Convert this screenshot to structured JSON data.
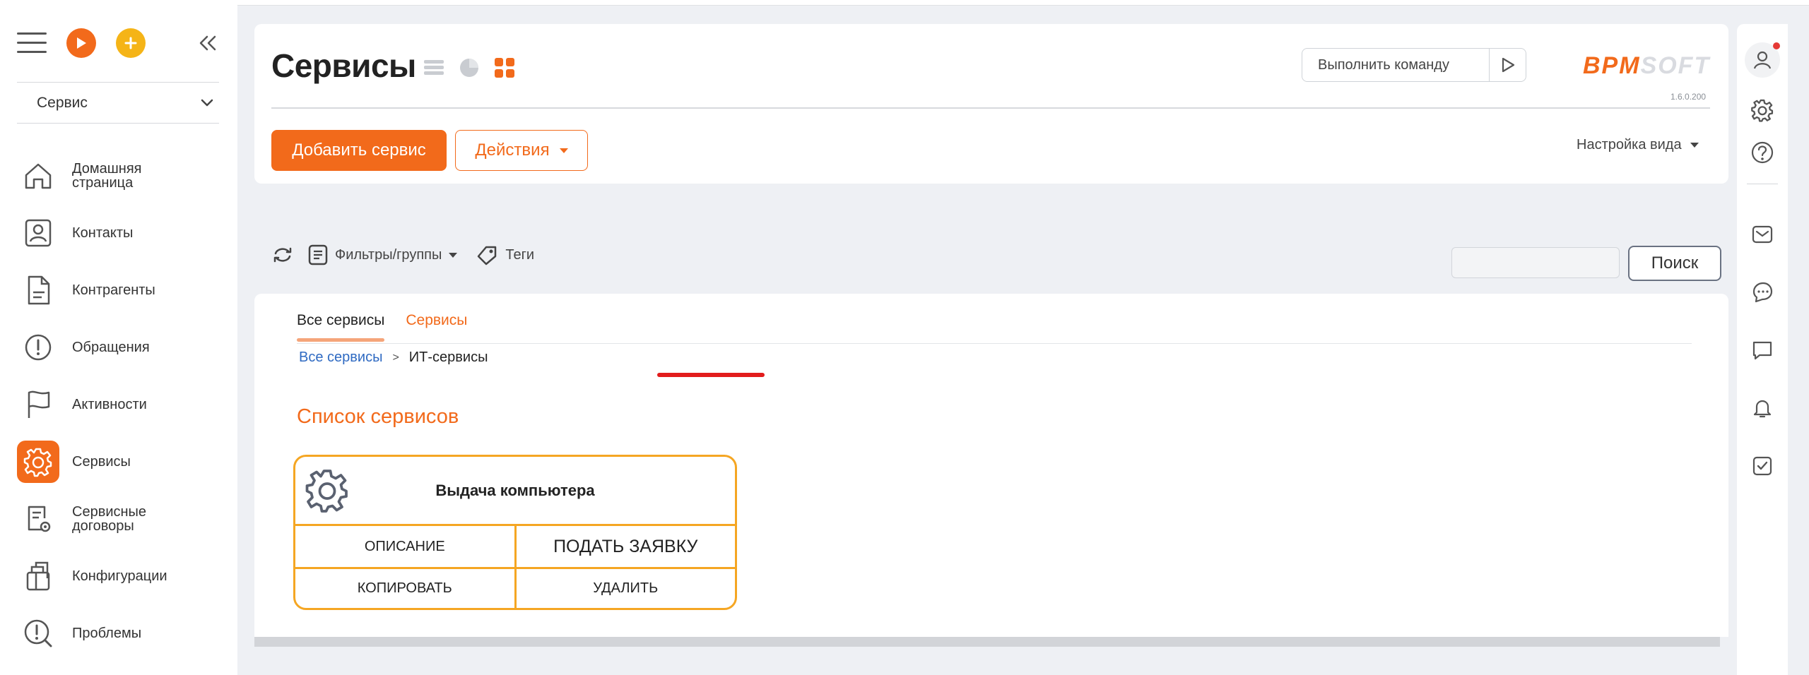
{
  "sidebar": {
    "workspace": "Сервис",
    "items": [
      {
        "label": "Домашняя страница",
        "icon": "home-icon",
        "active": false
      },
      {
        "label": "Контакты",
        "icon": "contact-icon",
        "active": false
      },
      {
        "label": "Контрагенты",
        "icon": "document-icon",
        "active": false
      },
      {
        "label": "Обращения",
        "icon": "alert-circle-icon",
        "active": false
      },
      {
        "label": "Активности",
        "icon": "flag-icon",
        "active": false
      },
      {
        "label": "Сервисы",
        "icon": "gear-icon",
        "active": true
      },
      {
        "label": "Сервисные договоры",
        "icon": "contract-icon",
        "active": false
      },
      {
        "label": "Конфигурации",
        "icon": "configuration-icon",
        "active": false
      },
      {
        "label": "Проблемы",
        "icon": "problem-icon",
        "active": false
      }
    ]
  },
  "header": {
    "title": "Сервисы",
    "command_placeholder": "Выполнить команду",
    "logo_left": "BPM",
    "logo_right": "SOFT",
    "version": "1.6.0.200",
    "add_button": "Добавить сервис",
    "actions_button": "Действия",
    "view_settings": "Настройка вида"
  },
  "filters": {
    "filters_label": "Фильтры/группы",
    "tags_label": "Теги",
    "search_button": "Поиск"
  },
  "content": {
    "tabs": [
      {
        "label": "Все сервисы",
        "active": true
      },
      {
        "label": "Сервисы",
        "active": false
      }
    ],
    "breadcrumb": {
      "root": "Все сервисы",
      "separator": ">",
      "current": "ИТ-сервисы"
    },
    "section_title": "Список сервисов",
    "service_card": {
      "name": "Выдача компьютера",
      "description_action": "ОПИСАНИЕ",
      "submit_action": "ПОДАТЬ ЗАЯВКУ",
      "copy_action": "КОПИРОВАТЬ",
      "delete_action": "УДАЛИТЬ"
    }
  },
  "colors": {
    "accent": "#f26a1b",
    "card_border": "#f5a623",
    "link": "#2f6ac2",
    "highlight_underline": "#e21c1c"
  }
}
